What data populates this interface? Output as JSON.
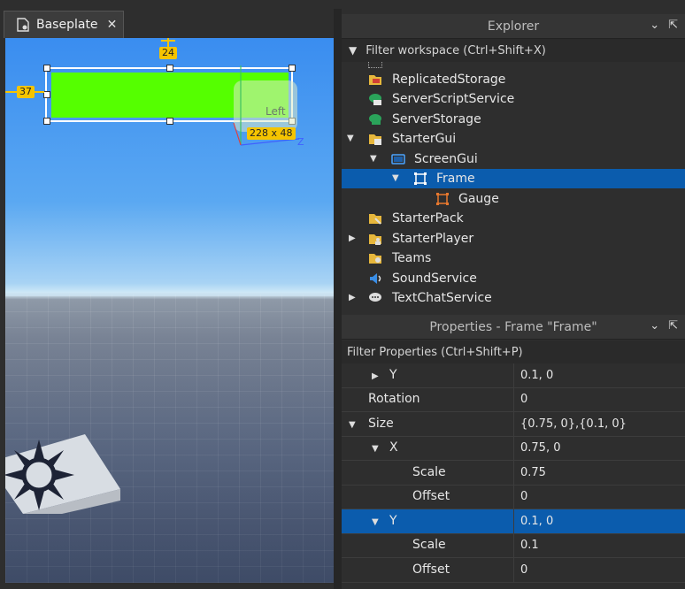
{
  "document_tab": {
    "title": "Baseplate",
    "close": "✕"
  },
  "viewport": {
    "badge_top": "24",
    "badge_left": "37",
    "size_badge": "228 x 48",
    "ghost_label": "Left",
    "axis_z": "Z",
    "frame_color": "#55ff00"
  },
  "explorer": {
    "title": "Explorer",
    "filter_placeholder": "Filter workspace (Ctrl+Shift+X)",
    "items": [
      {
        "label": "ReplicatedStorage",
        "icon": "replicated-storage-icon"
      },
      {
        "label": "ServerScriptService",
        "icon": "server-script-service-icon"
      },
      {
        "label": "ServerStorage",
        "icon": "server-storage-icon"
      },
      {
        "label": "StarterGui",
        "icon": "starter-gui-icon"
      },
      {
        "label": "ScreenGui",
        "icon": "screen-gui-icon"
      },
      {
        "label": "Frame",
        "icon": "frame-icon"
      },
      {
        "label": "Gauge",
        "icon": "frame-icon"
      },
      {
        "label": "StarterPack",
        "icon": "starter-pack-icon"
      },
      {
        "label": "StarterPlayer",
        "icon": "starter-player-icon"
      },
      {
        "label": "Teams",
        "icon": "teams-icon"
      },
      {
        "label": "SoundService",
        "icon": "sound-service-icon"
      },
      {
        "label": "TextChatService",
        "icon": "text-chat-service-icon"
      }
    ]
  },
  "properties": {
    "title": "Properties - Frame \"Frame\"",
    "filter_placeholder": "Filter Properties (Ctrl+Shift+P)",
    "rows": [
      {
        "name": "Y",
        "value": "0.1, 0"
      },
      {
        "name": "Rotation",
        "value": "0"
      },
      {
        "name": "Size",
        "value": "{0.75, 0},{0.1, 0}"
      },
      {
        "name": "X",
        "value": "0.75, 0"
      },
      {
        "name": "Scale",
        "value": "0.75"
      },
      {
        "name": "Offset",
        "value": "0"
      },
      {
        "name": "Y",
        "value": "0.1, 0"
      },
      {
        "name": "Scale",
        "value": "0.1"
      },
      {
        "name": "Offset",
        "value": "0"
      }
    ]
  }
}
